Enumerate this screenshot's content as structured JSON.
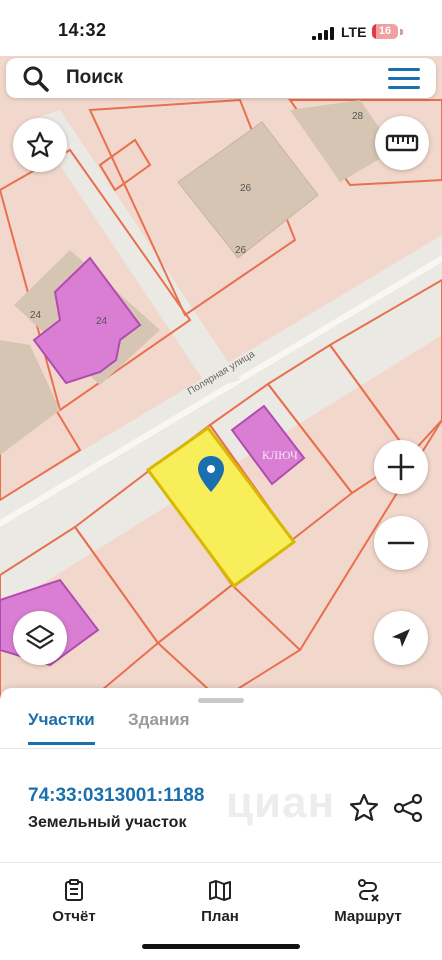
{
  "status_bar": {
    "time": "14:32",
    "network": "LTE",
    "battery": "16",
    "battery_level": 0.16
  },
  "search": {
    "placeholder": "Поиск"
  },
  "map": {
    "street_name": "Полярная улица",
    "house_numbers": [
      "28",
      "26",
      "26",
      "24",
      "24"
    ],
    "watermark_text": "КЛЮЧ",
    "colors": {
      "parcel_fill": "#f2d8cc",
      "parcel_border": "#e8704f",
      "road": "#eaeae6",
      "building": "#d6c5b3",
      "building_purple": "#d97ed3",
      "building_purple_border": "#b04cb0",
      "selected_parcel": "#f7ee5a",
      "selected_border": "#d8b800",
      "pin": "#1a6fae"
    }
  },
  "sheet": {
    "tabs": [
      {
        "label": "Участки",
        "active": true
      },
      {
        "label": "Здания",
        "active": false
      }
    ],
    "parcel": {
      "id": "74:33:0313001:1188",
      "type": "Земельный участок"
    },
    "watermark": "циан"
  },
  "bottom_nav": [
    {
      "label": "Отчёт",
      "icon": "report-icon"
    },
    {
      "label": "План",
      "icon": "map-plan-icon"
    },
    {
      "label": "Маршрут",
      "icon": "route-icon"
    }
  ],
  "accent_color": "#1a6fae"
}
